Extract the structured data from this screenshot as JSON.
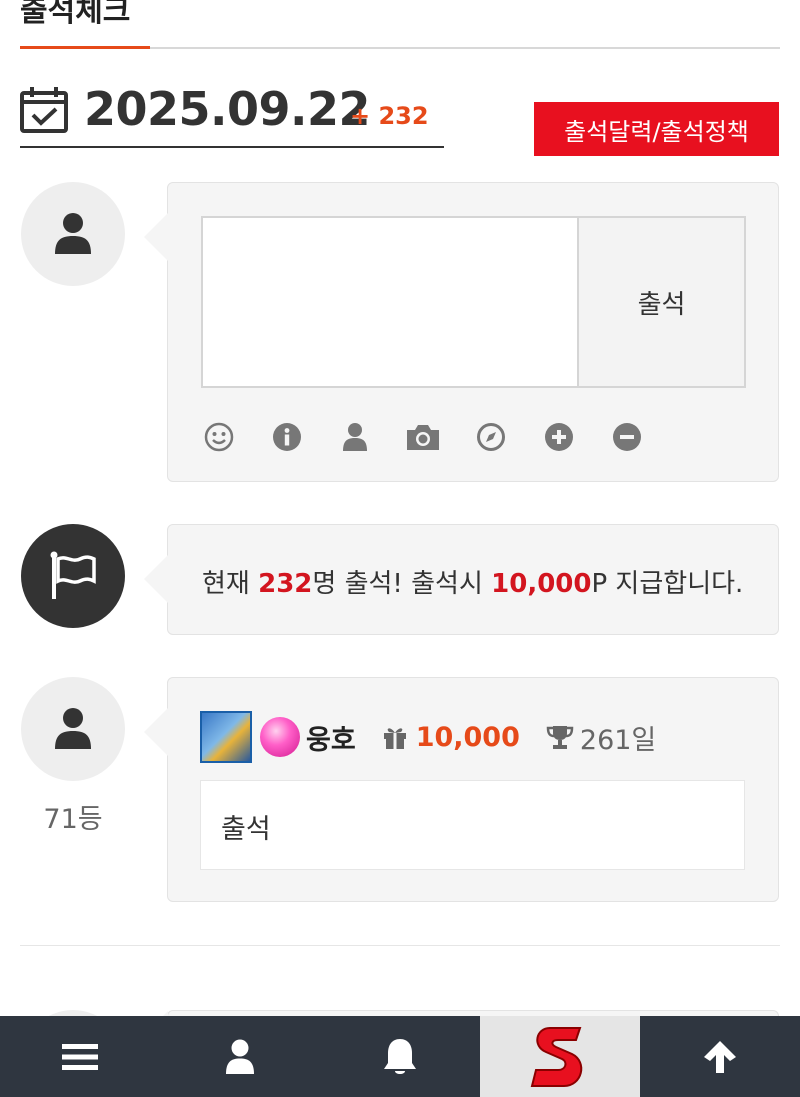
{
  "page": {
    "title": "출석체크"
  },
  "date_row": {
    "date": "2025.09.22",
    "count": "+ 232"
  },
  "policy_button": {
    "label": "출석달력/출석정책"
  },
  "write_box": {
    "submit_label": "출석"
  },
  "notice": {
    "prefix": "현재 ",
    "count": "232",
    "middle": "명 출석! 출석시 ",
    "points": "10,000",
    "suffix": "P 지급합니다."
  },
  "entry": {
    "user_name": "웅호",
    "points": "10,000",
    "days": "261일",
    "message": "출석",
    "rank": "71등"
  },
  "colors": {
    "accent": "#e64a19",
    "button": "#e8101f",
    "nav": "#2f3640"
  },
  "icons": {
    "toolbar": [
      "smile-icon",
      "info-icon",
      "user-icon",
      "camera-icon",
      "compass-icon",
      "plus-circle-icon",
      "minus-circle-icon"
    ],
    "nav": [
      "menu-icon",
      "user-icon",
      "bell-icon",
      "site-logo",
      "arrow-up-icon"
    ]
  }
}
